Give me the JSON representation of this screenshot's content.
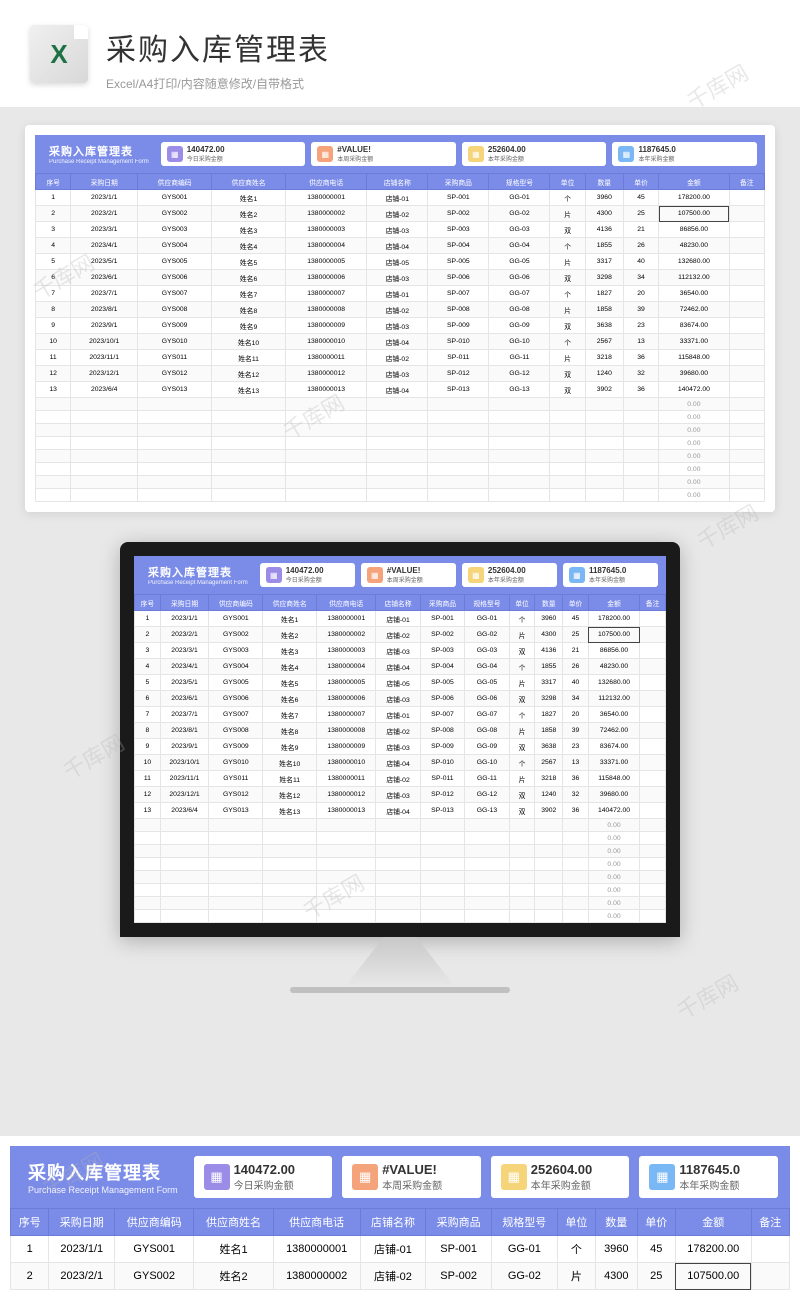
{
  "page_title": "采购入库管理表",
  "page_subtitle": "Excel/A4打印/内容随意修改/自带格式",
  "sheet": {
    "title_cn": "采购入库管理表",
    "title_en": "Purchase Receipt Management Form",
    "kpis": [
      {
        "value": "140472.00",
        "label": "今日采购金额",
        "icon": "purple"
      },
      {
        "value": "#VALUE!",
        "label": "本周采购金额",
        "icon": "orange"
      },
      {
        "value": "252604.00",
        "label": "本年采购金额",
        "icon": "yellow"
      },
      {
        "value": "1187645.0",
        "label": "本年采购金额",
        "icon": "blue"
      }
    ],
    "columns": [
      "序号",
      "采购日期",
      "供应商编码",
      "供应商姓名",
      "供应商电话",
      "店铺名称",
      "采购商品",
      "规格型号",
      "单位",
      "数量",
      "单价",
      "金额",
      "备注"
    ],
    "rows": [
      [
        "1",
        "2023/1/1",
        "GYS001",
        "姓名1",
        "1380000001",
        "店铺-01",
        "SP-001",
        "GG-01",
        "个",
        "3960",
        "45",
        "178200.00",
        ""
      ],
      [
        "2",
        "2023/2/1",
        "GYS002",
        "姓名2",
        "1380000002",
        "店铺-02",
        "SP-002",
        "GG-02",
        "片",
        "4300",
        "25",
        "107500.00",
        ""
      ],
      [
        "3",
        "2023/3/1",
        "GYS003",
        "姓名3",
        "1380000003",
        "店铺-03",
        "SP-003",
        "GG-03",
        "双",
        "4136",
        "21",
        "86856.00",
        ""
      ],
      [
        "4",
        "2023/4/1",
        "GYS004",
        "姓名4",
        "1380000004",
        "店铺-04",
        "SP-004",
        "GG-04",
        "个",
        "1855",
        "26",
        "48230.00",
        ""
      ],
      [
        "5",
        "2023/5/1",
        "GYS005",
        "姓名5",
        "1380000005",
        "店铺-05",
        "SP-005",
        "GG-05",
        "片",
        "3317",
        "40",
        "132680.00",
        ""
      ],
      [
        "6",
        "2023/6/1",
        "GYS006",
        "姓名6",
        "1380000006",
        "店铺-03",
        "SP-006",
        "GG-06",
        "双",
        "3298",
        "34",
        "112132.00",
        ""
      ],
      [
        "7",
        "2023/7/1",
        "GYS007",
        "姓名7",
        "1380000007",
        "店铺-01",
        "SP-007",
        "GG-07",
        "个",
        "1827",
        "20",
        "36540.00",
        ""
      ],
      [
        "8",
        "2023/8/1",
        "GYS008",
        "姓名8",
        "1380000008",
        "店铺-02",
        "SP-008",
        "GG-08",
        "片",
        "1858",
        "39",
        "72462.00",
        ""
      ],
      [
        "9",
        "2023/9/1",
        "GYS009",
        "姓名9",
        "1380000009",
        "店铺-03",
        "SP-009",
        "GG-09",
        "双",
        "3638",
        "23",
        "83674.00",
        ""
      ],
      [
        "10",
        "2023/10/1",
        "GYS010",
        "姓名10",
        "1380000010",
        "店铺-04",
        "SP-010",
        "GG-10",
        "个",
        "2567",
        "13",
        "33371.00",
        ""
      ],
      [
        "11",
        "2023/11/1",
        "GYS011",
        "姓名11",
        "1380000011",
        "店铺-02",
        "SP-011",
        "GG-11",
        "片",
        "3218",
        "36",
        "115848.00",
        ""
      ],
      [
        "12",
        "2023/12/1",
        "GYS012",
        "姓名12",
        "1380000012",
        "店铺-03",
        "SP-012",
        "GG-12",
        "双",
        "1240",
        "32",
        "39680.00",
        ""
      ],
      [
        "13",
        "2023/6/4",
        "GYS013",
        "姓名13",
        "1380000013",
        "店铺-04",
        "SP-013",
        "GG-13",
        "双",
        "3902",
        "36",
        "140472.00",
        ""
      ]
    ],
    "empty_rows": 8,
    "empty_amount": "0.00",
    "highlight_row": 1,
    "highlight_col": 11
  },
  "watermark": "千库网"
}
